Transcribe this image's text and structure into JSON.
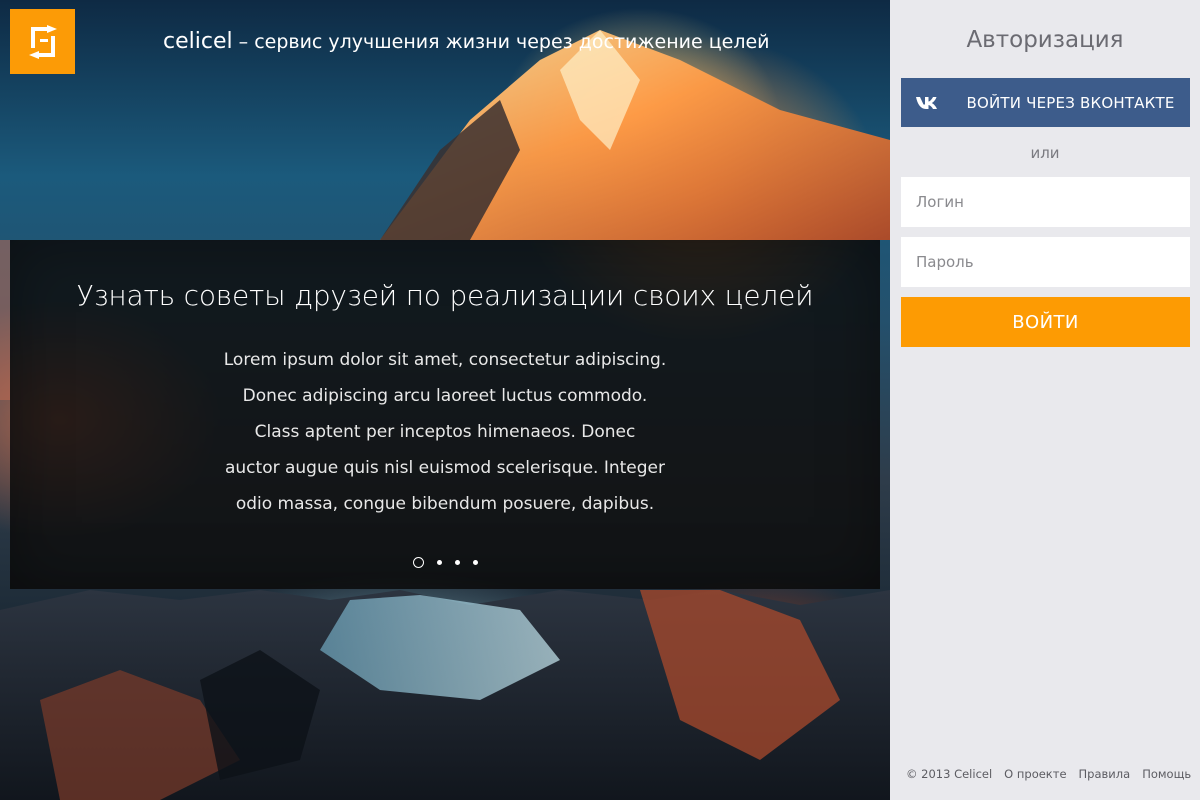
{
  "header": {
    "brand": "celicel",
    "tagline": " – сервис улучшения жизни через достижение целей",
    "logo_icon": "celicel-logo-icon",
    "accent_color": "#fc9b06"
  },
  "slider": {
    "title": "Узнать советы друзей по реализации своих целей",
    "text_lines": [
      "Lorem ipsum dolor sit amet, consectetur adipiscing.",
      "Donec adipiscing arcu laoreet luctus commodo.",
      "Class aptent per inceptos himenaeos. Donec",
      "auctor augue quis nisl euismod scelerisque. Integer",
      "odio massa, congue bibendum posuere, dapibus."
    ],
    "slide_count": 4,
    "active_slide": 1
  },
  "auth": {
    "title": "Авторизация",
    "vk_button_label": "ВОЙТИ ЧЕРЕЗ ВКОНТАКТЕ",
    "vk_icon": "vk-icon",
    "vk_color": "#3d5c8b",
    "or_text": "или",
    "login_placeholder": "Логин",
    "password_placeholder": "Пароль",
    "submit_label": "ВОЙТИ",
    "submit_color": "#fd9b03"
  },
  "footer": {
    "copyright": "© 2013 Celicel",
    "links": [
      "О проекте",
      "Правила",
      "Помощь"
    ]
  }
}
